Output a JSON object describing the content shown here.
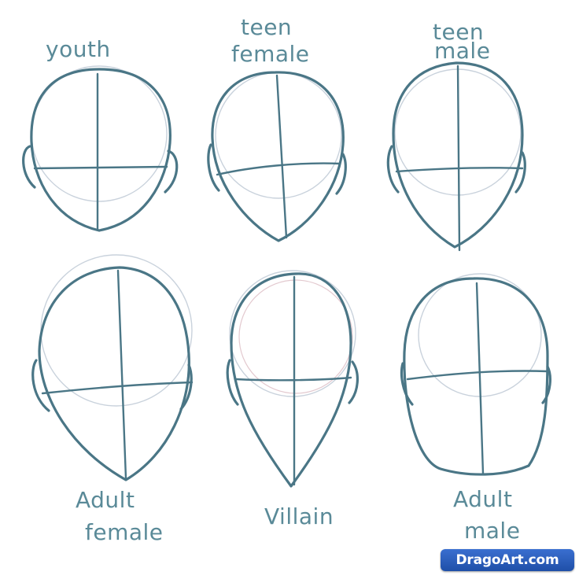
{
  "labels": {
    "youth": "youth",
    "teen_female_1": "teen",
    "teen_female_2": "female",
    "teen_male_1": "teen",
    "teen_male_2": "male",
    "adult_female_1": "Adult",
    "adult_female_2": "female",
    "villain": "Villain",
    "adult_male_1": "Adult",
    "adult_male_2": "male"
  },
  "watermark": "DragoArt.com",
  "colors": {
    "line": "#4a7686",
    "label": "#5a8a98",
    "watermark_bg": "#2a5fbf"
  }
}
